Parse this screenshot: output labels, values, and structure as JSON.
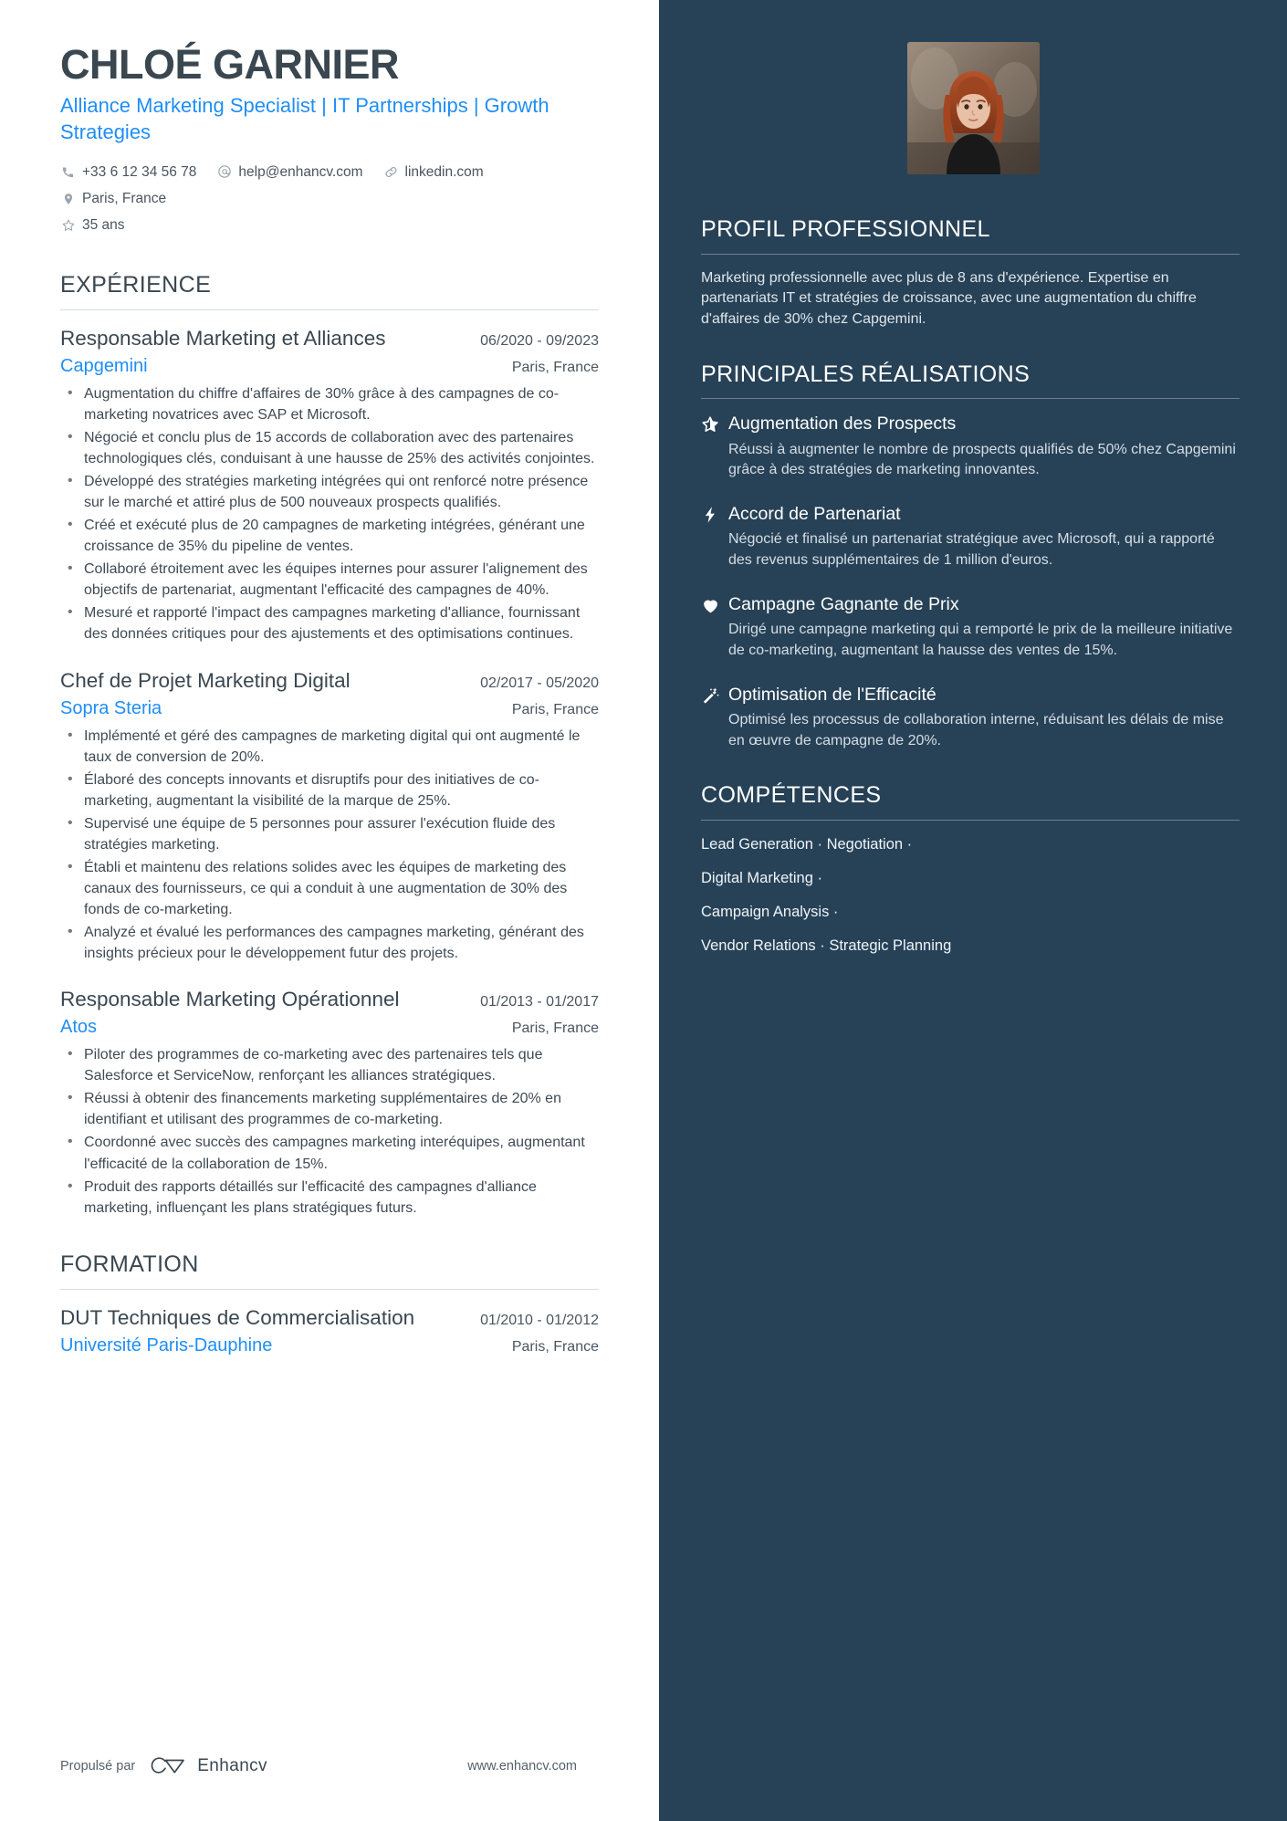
{
  "colors": {
    "accent_blue": "#1f8ef7",
    "sidebar_bg": "#274257",
    "text_dark": "#3a4750",
    "rule": "#d8dde1"
  },
  "header": {
    "name": "CHLOÉ GARNIER",
    "headline": "Alliance Marketing Specialist | IT Partnerships | Growth Strategies",
    "contacts": [
      {
        "icon": "phone-icon",
        "text": "+33 6 12 34 56 78"
      },
      {
        "icon": "email-icon",
        "text": "help@enhancv.com"
      },
      {
        "icon": "link-icon",
        "text": "linkedin.com"
      },
      {
        "icon": "location-pin-icon",
        "text": "Paris, France"
      }
    ],
    "contacts_second_row": [
      {
        "icon": "star-outline-icon",
        "text": "35 ans"
      }
    ]
  },
  "experience": {
    "title": "EXPÉRIENCE",
    "entries": [
      {
        "role": "Responsable Marketing et Alliances",
        "date": "06/2020 - 09/2023",
        "company": "Capgemini",
        "location": "Paris, France",
        "bullets": [
          "Augmentation du chiffre d'affaires de 30% grâce à des campagnes de co-marketing novatrices avec SAP et Microsoft.",
          "Négocié et conclu plus de 15 accords de collaboration avec des partenaires technologiques clés, conduisant à une hausse de 25% des activités conjointes.",
          "Développé des stratégies marketing intégrées qui ont renforcé notre présence sur le marché et attiré plus de 500 nouveaux prospects qualifiés.",
          "Créé et exécuté plus de 20 campagnes de marketing intégrées, générant une croissance de 35% du pipeline de ventes.",
          "Collaboré étroitement avec les équipes internes pour assurer l'alignement des objectifs de partenariat, augmentant l'efficacité des campagnes de 40%.",
          "Mesuré et rapporté l'impact des campagnes marketing d'alliance, fournissant des données critiques pour des ajustements et des optimisations continues."
        ]
      },
      {
        "role": "Chef de Projet Marketing Digital",
        "date": "02/2017 - 05/2020",
        "company": "Sopra Steria",
        "location": "Paris, France",
        "bullets": [
          "Implémenté et géré des campagnes de marketing digital qui ont augmenté le taux de conversion de 20%.",
          "Élaboré des concepts innovants et disruptifs pour des initiatives de co-marketing, augmentant la visibilité de la marque de 25%.",
          "Supervisé une équipe de 5 personnes pour assurer l'exécution fluide des stratégies marketing.",
          "Établi et maintenu des relations solides avec les équipes de marketing des canaux des fournisseurs, ce qui a conduit à une augmentation de 30% des fonds de co-marketing.",
          "Analyzé et évalué les performances des campagnes marketing, générant des insights précieux pour le développement futur des projets."
        ]
      },
      {
        "role": "Responsable Marketing Opérationnel",
        "date": "01/2013 - 01/2017",
        "company": "Atos",
        "location": "Paris, France",
        "bullets": [
          "Piloter des programmes de co-marketing avec des partenaires tels que Salesforce et ServiceNow, renforçant les alliances stratégiques.",
          "Réussi à obtenir des financements marketing supplémentaires de 20% en identifiant et utilisant des programmes de co-marketing.",
          "Coordonné avec succès des campagnes marketing interéquipes, augmentant l'efficacité de la collaboration de 15%.",
          "Produit des rapports détaillés sur l'efficacité des campagnes d'alliance marketing, influençant les plans stratégiques futurs."
        ]
      }
    ]
  },
  "education": {
    "title": "FORMATION",
    "entries": [
      {
        "degree": "DUT Techniques de Commercialisation",
        "date": "01/2010 - 01/2012",
        "school": "Université Paris-Dauphine",
        "location": "Paris, France"
      }
    ]
  },
  "sidebar": {
    "profile": {
      "title": "PROFIL PROFESSIONNEL",
      "text": "Marketing professionnelle avec plus de 8 ans d'expérience. Expertise en partenariats IT et stratégies de croissance, avec une augmentation du chiffre d'affaires de 30% chez Capgemini."
    },
    "achievements": {
      "title": "PRINCIPALES RÉALISATIONS",
      "items": [
        {
          "icon": "half-star-icon",
          "title": "Augmentation des Prospects",
          "desc": "Réussi à augmenter le nombre de prospects qualifiés de 50% chez Capgemini grâce à des stratégies de marketing innovantes."
        },
        {
          "icon": "lightning-bolt-icon",
          "title": "Accord de Partenariat",
          "desc": "Négocié et finalisé un partenariat stratégique avec Microsoft, qui a rapporté des revenus supplémentaires de 1 million d'euros."
        },
        {
          "icon": "heart-icon",
          "title": "Campagne Gagnante de Prix",
          "desc": "Dirigé une campagne marketing qui a remporté le prix de la meilleure initiative de co-marketing, augmentant la hausse des ventes de 15%."
        },
        {
          "icon": "magic-wand-icon",
          "title": "Optimisation de l'Efficacité",
          "desc": "Optimisé les processus de collaboration interne, réduisant les délais de mise en œuvre de campagne de 20%."
        }
      ]
    },
    "skills": {
      "title": "COMPÉTENCES",
      "lines": [
        "Lead Generation · Negotiation ·",
        "Digital Marketing ·",
        "Campaign Analysis ·",
        "Vendor Relations · Strategic Planning"
      ]
    }
  },
  "footer": {
    "powered_by": "Propulsé par",
    "brand": "Enhancv",
    "website": "www.enhancv.com"
  }
}
